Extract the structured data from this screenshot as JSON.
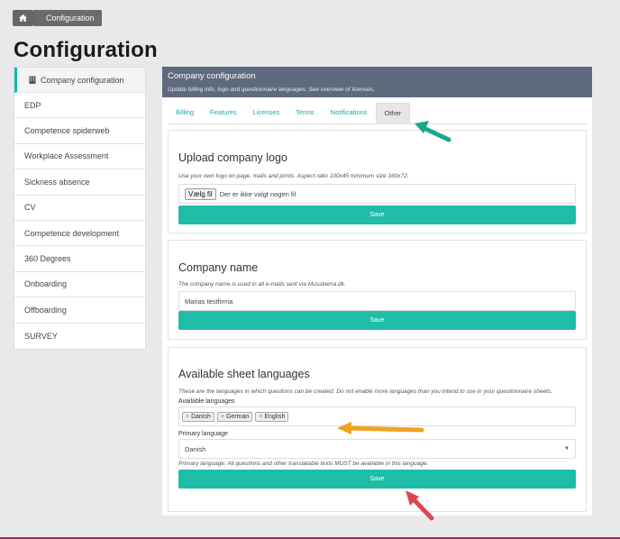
{
  "breadcrumb": {
    "current": "Configuration"
  },
  "page_title": "Configuration",
  "sidebar": {
    "items": [
      {
        "label": "Company configuration",
        "active": true
      },
      {
        "label": "EDP"
      },
      {
        "label": "Competence spiderweb"
      },
      {
        "label": "Workplace Assessment"
      },
      {
        "label": "Sickness absence"
      },
      {
        "label": "CV"
      },
      {
        "label": "Competence development"
      },
      {
        "label": "360 Degrees"
      },
      {
        "label": "Onboarding"
      },
      {
        "label": "Offboarding"
      },
      {
        "label": "SURVEY"
      }
    ]
  },
  "panel": {
    "title": "Company configuration",
    "subtitle": "Update billing info, logo and questionnaire languages. See overview of licenses.",
    "tabs": [
      {
        "label": "Billing"
      },
      {
        "label": "Features"
      },
      {
        "label": "Licenses"
      },
      {
        "label": "Terms"
      },
      {
        "label": "Notifications"
      },
      {
        "label": "Other",
        "active": true
      }
    ]
  },
  "logo_section": {
    "title": "Upload company logo",
    "help": "Use your own logo on page, mails and prints. Aspect ratio 100x45 minimum size 160x72.",
    "file_button": "Vælg fil",
    "file_status": "Der er ikke valgt nogen fil",
    "save_label": "Save"
  },
  "name_section": {
    "title": "Company name",
    "help": "The company name is used in all e-mails sent via Musskema.dk.",
    "value": "Marias testfirma",
    "save_label": "Save"
  },
  "lang_section": {
    "title": "Available sheet languages",
    "help": "These are the languages in which questions can be created. Do not enable more languages than you intend to use in your questionnaire sheets.",
    "available_label": "Available languages",
    "languages": [
      "Danish",
      "German",
      "English"
    ],
    "primary_label": "Primary language",
    "primary_value": "Danish",
    "primary_note": "Primary language: All questions and other translatable texts MUST be available in this language.",
    "save_label": "Save"
  },
  "colors": {
    "accent": "#1fbca8",
    "header": "#5e6a7d",
    "arrow_green": "#1aa78a",
    "arrow_orange": "#f0a21f",
    "arrow_red": "#e0474c"
  }
}
